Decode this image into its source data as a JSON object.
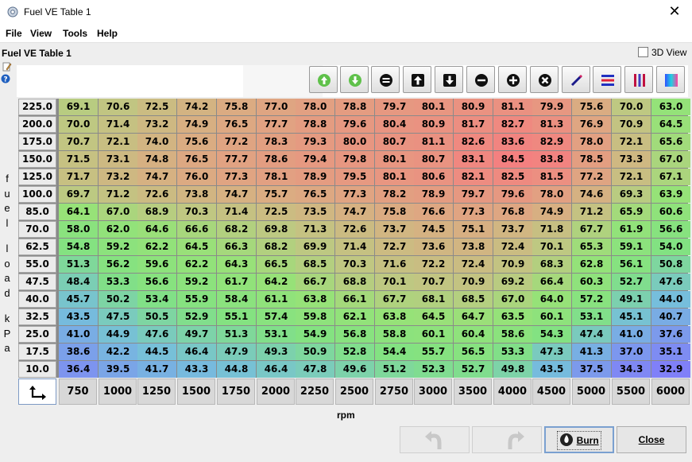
{
  "window": {
    "title": "Fuel VE Table 1",
    "close_glyph": "✕"
  },
  "menu": [
    "File",
    "View",
    "Tools",
    "Help"
  ],
  "table_title": "Fuel VE Table 1",
  "view3d_label": "3D View",
  "toolbar_icons": [
    "increase-green-icon",
    "decrease-green-icon",
    "set-equal-icon",
    "shift-up-icon",
    "shift-down-icon",
    "subtract-icon",
    "add-icon",
    "multiply-icon",
    "interpolate-pencil-icon",
    "smooth-rows-icon",
    "smooth-columns-icon",
    "color-scale-icon"
  ],
  "y_axis_label": "fuel load kPa",
  "x_axis_label": "rpm",
  "rows": [
    "225.0",
    "200.0",
    "175.0",
    "150.0",
    "125.0",
    "100.0",
    "85.0",
    "70.0",
    "62.5",
    "55.0",
    "47.5",
    "40.0",
    "32.5",
    "25.0",
    "17.5",
    "10.0"
  ],
  "cols": [
    "750",
    "1000",
    "1250",
    "1500",
    "1750",
    "2000",
    "2250",
    "2500",
    "2750",
    "3000",
    "3500",
    "4000",
    "4500",
    "5000",
    "5500",
    "6000"
  ],
  "cells": [
    [
      "69.1",
      "70.6",
      "72.5",
      "74.2",
      "75.8",
      "77.0",
      "78.0",
      "78.8",
      "79.7",
      "80.1",
      "80.9",
      "81.1",
      "79.9",
      "75.6",
      "70.0",
      "63.0"
    ],
    [
      "70.0",
      "71.4",
      "73.2",
      "74.9",
      "76.5",
      "77.7",
      "78.8",
      "79.6",
      "80.4",
      "80.9",
      "81.7",
      "82.7",
      "81.3",
      "76.9",
      "70.9",
      "64.5"
    ],
    [
      "70.7",
      "72.1",
      "74.0",
      "75.6",
      "77.2",
      "78.3",
      "79.3",
      "80.0",
      "80.7",
      "81.1",
      "82.6",
      "83.6",
      "82.9",
      "78.0",
      "72.1",
      "65.6"
    ],
    [
      "71.5",
      "73.1",
      "74.8",
      "76.5",
      "77.7",
      "78.6",
      "79.4",
      "79.8",
      "80.1",
      "80.7",
      "83.1",
      "84.5",
      "83.8",
      "78.5",
      "73.3",
      "67.0"
    ],
    [
      "71.7",
      "73.2",
      "74.7",
      "76.0",
      "77.3",
      "78.1",
      "78.9",
      "79.5",
      "80.1",
      "80.6",
      "82.1",
      "82.5",
      "81.5",
      "77.2",
      "72.1",
      "67.1"
    ],
    [
      "69.7",
      "71.2",
      "72.6",
      "73.8",
      "74.7",
      "75.7",
      "76.5",
      "77.3",
      "78.2",
      "78.9",
      "79.7",
      "79.6",
      "78.0",
      "74.6",
      "69.3",
      "63.9"
    ],
    [
      "64.1",
      "67.0",
      "68.9",
      "70.3",
      "71.4",
      "72.5",
      "73.5",
      "74.7",
      "75.8",
      "76.6",
      "77.3",
      "76.8",
      "74.9",
      "71.2",
      "65.9",
      "60.6"
    ],
    [
      "58.0",
      "62.0",
      "64.6",
      "66.6",
      "68.2",
      "69.8",
      "71.3",
      "72.6",
      "73.7",
      "74.5",
      "75.1",
      "73.7",
      "71.8",
      "67.7",
      "61.9",
      "56.6"
    ],
    [
      "54.8",
      "59.2",
      "62.2",
      "64.5",
      "66.3",
      "68.2",
      "69.9",
      "71.4",
      "72.7",
      "73.6",
      "73.8",
      "72.4",
      "70.1",
      "65.3",
      "59.1",
      "54.0"
    ],
    [
      "51.3",
      "56.2",
      "59.6",
      "62.2",
      "64.3",
      "66.5",
      "68.5",
      "70.3",
      "71.6",
      "72.2",
      "72.4",
      "70.9",
      "68.3",
      "62.8",
      "56.1",
      "50.8"
    ],
    [
      "48.4",
      "53.3",
      "56.6",
      "59.2",
      "61.7",
      "64.2",
      "66.7",
      "68.8",
      "70.1",
      "70.7",
      "70.9",
      "69.2",
      "66.4",
      "60.3",
      "52.7",
      "47.6"
    ],
    [
      "45.7",
      "50.2",
      "53.4",
      "55.9",
      "58.4",
      "61.1",
      "63.8",
      "66.1",
      "67.7",
      "68.1",
      "68.5",
      "67.0",
      "64.0",
      "57.2",
      "49.1",
      "44.0"
    ],
    [
      "43.5",
      "47.5",
      "50.5",
      "52.9",
      "55.1",
      "57.4",
      "59.8",
      "62.1",
      "63.8",
      "64.5",
      "64.7",
      "63.5",
      "60.1",
      "53.1",
      "45.1",
      "40.7"
    ],
    [
      "41.0",
      "44.9",
      "47.6",
      "49.7",
      "51.3",
      "53.1",
      "54.9",
      "56.8",
      "58.8",
      "60.1",
      "60.4",
      "58.6",
      "54.3",
      "47.4",
      "41.0",
      "37.6"
    ],
    [
      "38.6",
      "42.2",
      "44.5",
      "46.4",
      "47.9",
      "49.3",
      "50.9",
      "52.8",
      "54.4",
      "55.7",
      "56.5",
      "53.3",
      "47.3",
      "41.3",
      "37.0",
      "35.1"
    ],
    [
      "36.4",
      "39.5",
      "41.7",
      "43.3",
      "44.8",
      "46.4",
      "47.8",
      "49.6",
      "51.2",
      "52.3",
      "52.7",
      "49.8",
      "43.5",
      "37.5",
      "34.3",
      "32.9"
    ]
  ],
  "buttons": {
    "burn": "Burn",
    "close": "Close"
  }
}
